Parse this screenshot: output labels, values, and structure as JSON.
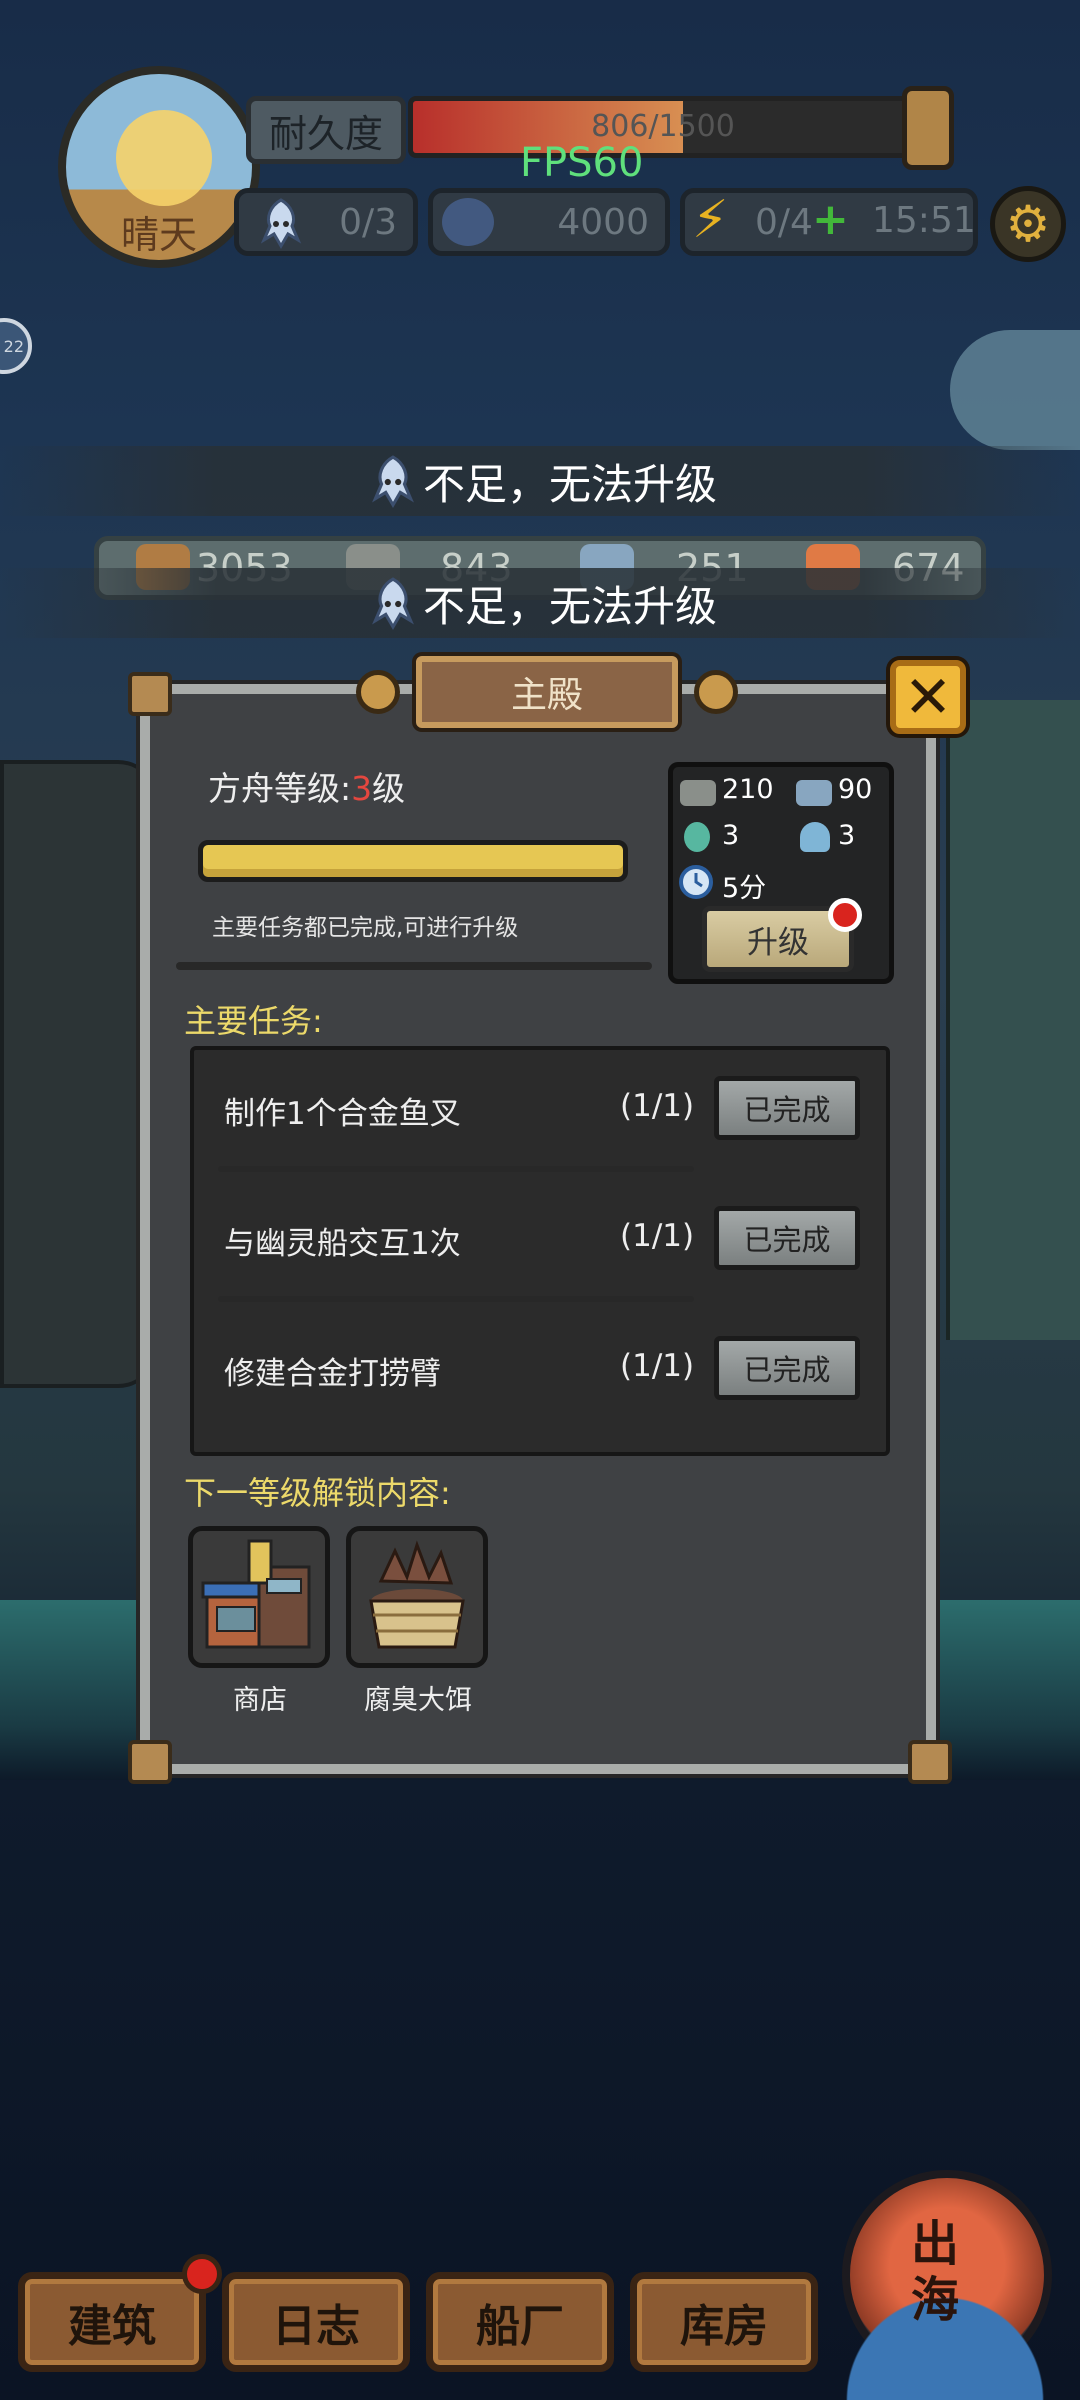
{
  "hud": {
    "weather": "晴天",
    "durability_label": "耐久度",
    "durability_text": "806/1500",
    "durability_fraction": 0.54,
    "fps": "FPS60",
    "crew": "0/3",
    "coins": "4000",
    "energy": "0/4",
    "timer": "15:51",
    "side_badge": "22"
  },
  "toasts": [
    {
      "text": "不足，无法升级"
    },
    {
      "text": "不足，无法升级"
    }
  ],
  "resources": [
    {
      "value": "3053",
      "icon": "wood-icon",
      "color": "#b07c44"
    },
    {
      "value": "843",
      "icon": "stone-icon",
      "color": "#8a8f8a"
    },
    {
      "value": "251",
      "icon": "metal-icon",
      "color": "#88a6c0"
    },
    {
      "value": "674",
      "icon": "food-icon",
      "color": "#e07a45"
    }
  ],
  "panel": {
    "title": "主殿",
    "ark_level_label": "方舟等级:",
    "ark_level_value": "3",
    "ark_level_unit": "级",
    "progress_fraction": 1.0,
    "status_note": "主要任务都已完成,可进行升级",
    "costs": [
      {
        "value": "210",
        "icon": "stone-icon",
        "color": "#8a8f8a"
      },
      {
        "value": "90",
        "icon": "metal-icon",
        "color": "#88a6c0"
      },
      {
        "value": "3",
        "icon": "potion-icon",
        "color": "#57b7a0"
      },
      {
        "value": "3",
        "icon": "shell-icon",
        "color": "#7fb5d6"
      }
    ],
    "time": "5分",
    "upgrade_label": "升级",
    "tasks_heading": "主要任务:",
    "tasks": [
      {
        "name": "制作1个合金鱼叉",
        "count": "(1/1)",
        "status": "已完成"
      },
      {
        "name": "与幽灵船交互1次",
        "count": "(1/1)",
        "status": "已完成"
      },
      {
        "name": "修建合金打捞臂",
        "count": "(1/1)",
        "status": "已完成"
      }
    ],
    "unlock_heading": "下一等级解锁内容:",
    "unlocks": [
      {
        "label": "商店",
        "icon": "shop-icon"
      },
      {
        "label": "腐臭大饵",
        "icon": "bait-bucket-icon"
      }
    ]
  },
  "nav": {
    "items": [
      {
        "label": "建筑"
      },
      {
        "label": "日志"
      },
      {
        "label": "船厂"
      },
      {
        "label": "库房"
      }
    ],
    "sea_button": "出海"
  }
}
